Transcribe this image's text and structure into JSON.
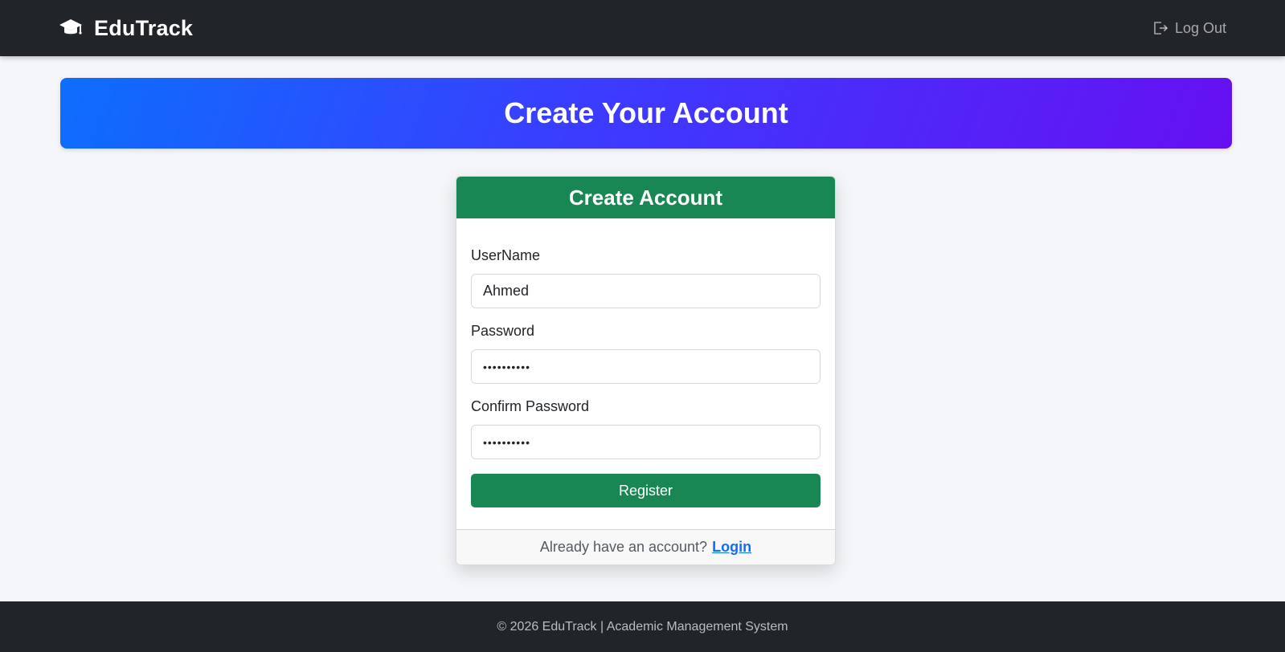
{
  "nav": {
    "brand": "EduTrack",
    "brand_icon": "graduation-cap-icon",
    "logout_label": "Log Out",
    "logout_icon": "logout-icon"
  },
  "hero": {
    "title": "Create Your Account",
    "gradient": [
      "#0d6efd",
      "#6610f2"
    ]
  },
  "card": {
    "title": "Create Account",
    "header_color": "#198754",
    "fields": [
      {
        "label": "UserName",
        "value": "Ahmed",
        "type": "text"
      },
      {
        "label": "Password",
        "value": "••••••••••",
        "type": "password"
      },
      {
        "label": "Confirm Password",
        "value": "••••••••••",
        "type": "password"
      }
    ],
    "submit_label": "Register",
    "footer_text": "Already have an account?",
    "footer_link": "Login"
  },
  "footer": {
    "text": "© 2026 EduTrack | Academic Management System"
  }
}
